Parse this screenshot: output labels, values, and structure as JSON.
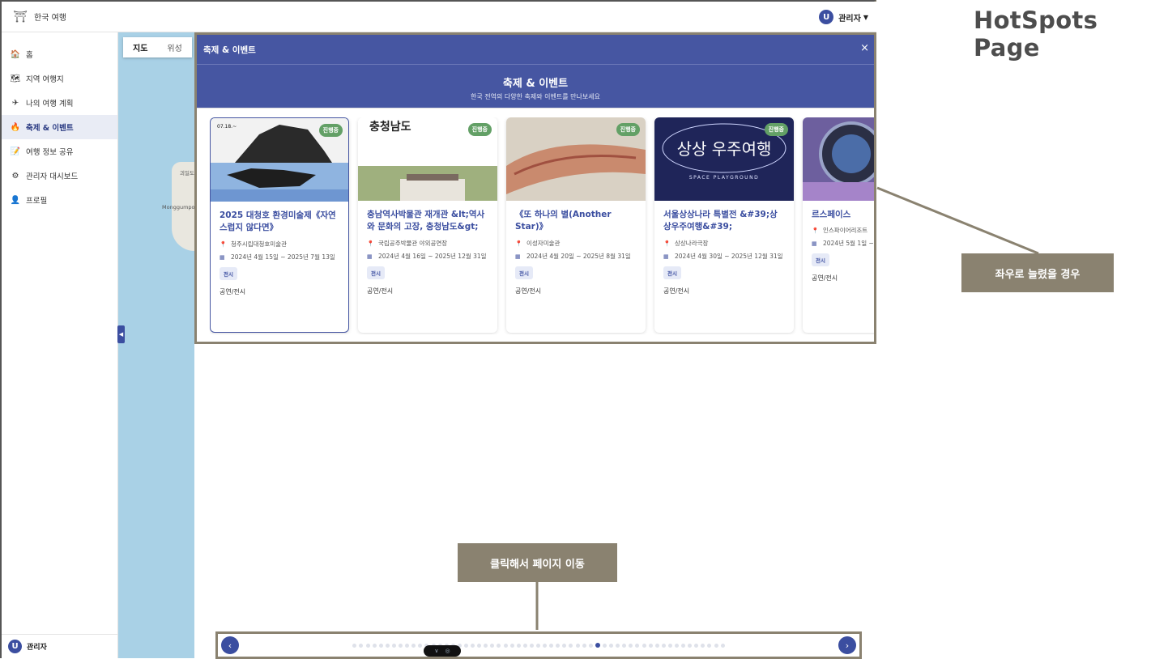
{
  "app": {
    "title": "한국 여행",
    "logo_icon": "temple-icon"
  },
  "user": {
    "initial": "U",
    "name": "관리자"
  },
  "sidebar": {
    "items": [
      {
        "label": "홈",
        "icon": "🏠"
      },
      {
        "label": "지역 여행지",
        "icon": "🗺"
      },
      {
        "label": "나의 여행 계획",
        "icon": "✈"
      },
      {
        "label": "축제 & 이벤트",
        "icon": "🔥"
      },
      {
        "label": "여행 정보 공유",
        "icon": "📝"
      },
      {
        "label": "관리자 대시보드",
        "icon": "⚙"
      },
      {
        "label": "프로필",
        "icon": "👤"
      }
    ],
    "active_index": 3
  },
  "map": {
    "tabs": [
      "지도",
      "위성"
    ],
    "labels": [
      "괴일도",
      "Monggumpo"
    ]
  },
  "modal": {
    "header_title": "축제 & 이벤트",
    "close_glyph": "×",
    "hero_title": "축제 & 이벤트",
    "hero_subtitle": "한국 전역의 다양한 축제와 이벤트를 만나보세요"
  },
  "cards": [
    {
      "title": "2025 대청호 환경미술제《자연스럽지 않다면》",
      "place": "청주시립대청호미술관",
      "date": "2024년 4월 15일 ~ 2025년 7월 13일",
      "tag": "전시",
      "category": "공연/전시",
      "badge": "진행중",
      "image_text": "07.18.~"
    },
    {
      "title": "충남역사박물관 재개관 &lt;역사와 문화의 고장, 충청남도&gt;",
      "place": "국립공주박물관 야외공연장",
      "date": "2024년 4월 16일 ~ 2025년 12월 31일",
      "tag": "전시",
      "category": "공연/전시",
      "badge": "진행중",
      "image_text": "충청남도"
    },
    {
      "title": "《또 하나의 별(Another Star)》",
      "place": "이성자미술관",
      "date": "2024년 4월 20일 ~ 2025년 8월 31일",
      "tag": "전시",
      "category": "공연/전시",
      "badge": "진행중",
      "image_text": ""
    },
    {
      "title": "서울상상나라 특별전 &#39;상상우주여행&#39;",
      "place": "상상나라극장",
      "date": "2024년 4월 30일 ~ 2025년 12월 31일",
      "tag": "전시",
      "category": "공연/전시",
      "badge": "진행중",
      "image_text": "상상 우주여행",
      "image_sub": "SPACE PLAYGROUND"
    },
    {
      "title": "르스페이스",
      "place": "인스파이어리조트",
      "date": "2024년 5월 1일 ~",
      "tag": "전시",
      "category": "공연/전시",
      "badge": "",
      "image_text": ""
    }
  ],
  "pager": {
    "prev": "‹",
    "next": "›",
    "dot_count": 57,
    "active_dot": 37
  },
  "annotations": {
    "page_title": "HotSpots Page",
    "stretch_note": "좌우로 늘렸을 경우",
    "click_note": "클릭해서 페이지 이동"
  },
  "colors": {
    "primary": "#3b4ea0",
    "header": "#4656a2",
    "badge": "#63a066",
    "annotation": "#8a8270"
  }
}
